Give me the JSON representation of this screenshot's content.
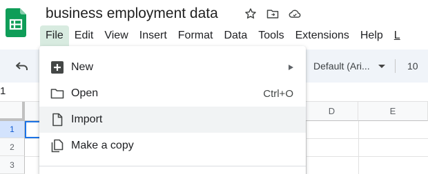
{
  "header": {
    "doc_title": "business employment data",
    "icons": [
      "star-icon",
      "move-to-folder-icon",
      "cloud-saved-icon"
    ]
  },
  "menubar": {
    "items": [
      {
        "label": "File",
        "active": true
      },
      {
        "label": "Edit"
      },
      {
        "label": "View"
      },
      {
        "label": "Insert"
      },
      {
        "label": "Format"
      },
      {
        "label": "Data"
      },
      {
        "label": "Tools"
      },
      {
        "label": "Extensions"
      },
      {
        "label": "Help"
      },
      {
        "label": "L"
      }
    ]
  },
  "toolbar": {
    "font_family": "Default (Ari...",
    "font_size": "10"
  },
  "formula_bar": {
    "cell_ref": "1"
  },
  "grid": {
    "columns": [
      "D",
      "E"
    ],
    "rows": [
      "1",
      "2",
      "3"
    ]
  },
  "file_menu": {
    "items": [
      {
        "label": "New",
        "icon": "plus-square-icon",
        "submenu": true
      },
      {
        "label": "Open",
        "icon": "folder-icon",
        "shortcut": "Ctrl+O"
      },
      {
        "label": "Import",
        "icon": "file-icon",
        "hovered": true
      },
      {
        "label": "Make a copy",
        "icon": "copy-icon"
      }
    ]
  },
  "colors": {
    "sheets_green": "#0f9d58",
    "menu_active_bg": "#d8ebe0",
    "toolbar_bg": "#f0f4f9",
    "selection_blue": "#1a73e8"
  }
}
